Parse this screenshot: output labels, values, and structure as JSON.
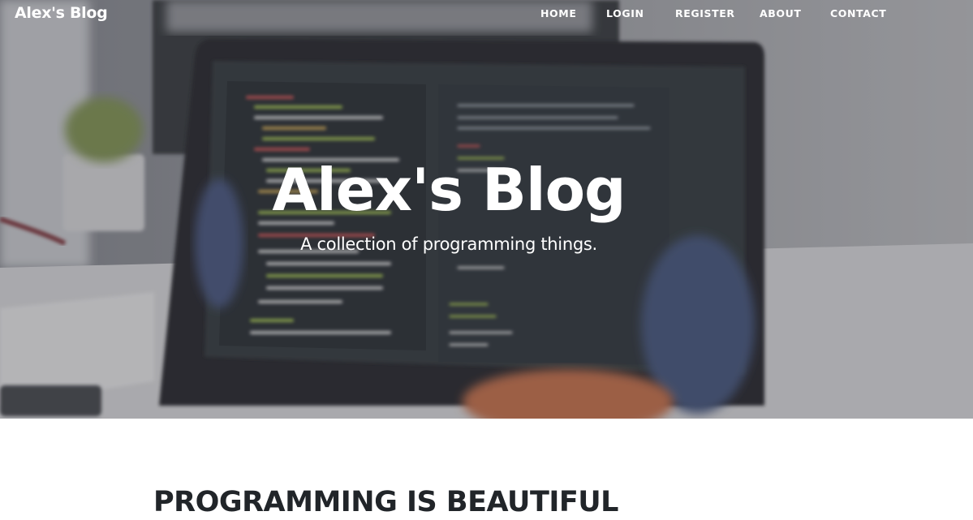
{
  "navbar": {
    "brand": "Alex's Blog",
    "links": [
      {
        "label": "HOME"
      },
      {
        "label": "LOGIN"
      },
      {
        "label": "REGISTER"
      },
      {
        "label": "ABOUT"
      },
      {
        "label": "CONTACT"
      }
    ]
  },
  "hero": {
    "background_image": "blurred-laptop-with-code-on-desk",
    "title": "Alex's Blog",
    "subtitle": "A collection of programming things."
  },
  "content": {
    "heading": "PROGRAMMING IS BEAUTIFUL"
  },
  "colors": {
    "nav_text": "#ffffff",
    "hero_text": "#ffffff",
    "heading_text": "#212529",
    "page_background": "#ffffff"
  }
}
